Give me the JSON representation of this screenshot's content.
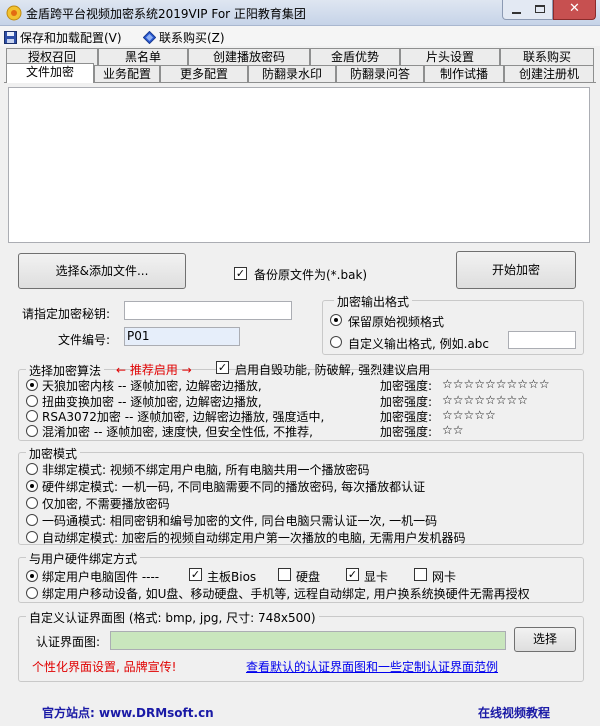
{
  "window": {
    "title": "金盾跨平台视频加密系统2019VIP For 正阳教育集团",
    "close_glyph": "✕"
  },
  "menu": {
    "items": [
      {
        "label": "保存和加载配置(V)"
      },
      {
        "label": "联系购买(Z)"
      }
    ]
  },
  "tabs": {
    "row1": [
      "授权召回",
      "黑名单",
      "创建播放密码",
      "金盾优势",
      "片头设置",
      "联系购买"
    ],
    "row2": [
      "文件加密",
      "业务配置",
      "更多配置",
      "防翻录水印",
      "防翻录问答",
      "制作试播",
      "创建注册机"
    ],
    "active": "文件加密"
  },
  "actions": {
    "select_add_files": "选择&添加文件...",
    "backup_label": "备份原文件为(*.bak)",
    "start_encrypt": "开始加密"
  },
  "fields": {
    "secret_label": "请指定加密秘钥:",
    "secret_value": "",
    "file_no_label": "文件编号:",
    "file_no_value": "P01"
  },
  "output_format": {
    "title": "加密输出格式",
    "keep_original": "保留原始视频格式",
    "custom_format": "自定义输出格式, 例如.abc",
    "custom_value": ""
  },
  "algorithm": {
    "title": "选择加密算法",
    "recommend": "← 推荐启用 →",
    "self_destruct": "启用自毁功能, 防破解, 强烈建议启用",
    "options": [
      {
        "label": "天狼加密内核 -- 逐帧加密, 边解密边播放,",
        "strength_label": "加密强度:",
        "stars": "☆☆☆☆☆☆☆☆☆☆"
      },
      {
        "label": "扭曲变换加密 -- 逐帧加密, 边解密边播放,",
        "strength_label": "加密强度:",
        "stars": "☆☆☆☆☆☆☆☆"
      },
      {
        "label": "RSA3072加密 --  逐帧加密, 边解密边播放, 强度适中,",
        "strength_label": "加密强度:",
        "stars": "☆☆☆☆☆"
      },
      {
        "label": "混淆加密 -- 逐帧加密, 速度快, 但安全性低, 不推荐,",
        "strength_label": "加密强度:",
        "stars": "☆☆"
      }
    ]
  },
  "encrypt_mode": {
    "title": "加密模式",
    "options": [
      "非绑定模式: 视频不绑定用户电脑, 所有电脑共用一个播放密码",
      "硬件绑定模式: 一机一码, 不同电脑需要不同的播放密码, 每次播放都认证",
      "仅加密, 不需要播放密码",
      "一码通模式: 相同密钥和编号加密的文件, 同台电脑只需认证一次, 一机一码",
      "自动绑定模式: 加密后的视频自动绑定用户第一次播放的电脑, 无需用户发机器码"
    ]
  },
  "hardware_bind": {
    "title": "与用户硬件绑定方式",
    "bind_firmware": "绑定用户电脑固件  ----",
    "mainboard": "主板Bios",
    "disk": "硬盘",
    "gpu": "显卡",
    "nic": "网卡",
    "bind_mobile": "绑定用户移动设备, 如U盘、移动硬盘、手机等, 远程自动绑定, 用户换系统换硬件无需再授权"
  },
  "custom_auth": {
    "title": "自定义认证界面图 (格式: bmp, jpg, 尺寸: 748x500)",
    "image_label": "认证界面图:",
    "image_value": "",
    "select_button": "选择",
    "promo": "个性化界面设置, 品牌宣传!",
    "sample_link": "查看默认的认证界面图和一些定制认证界面范例"
  },
  "footer": {
    "site_label": "官方站点: www.DRMsoft.cn",
    "tutorial": "在线视频教程"
  }
}
